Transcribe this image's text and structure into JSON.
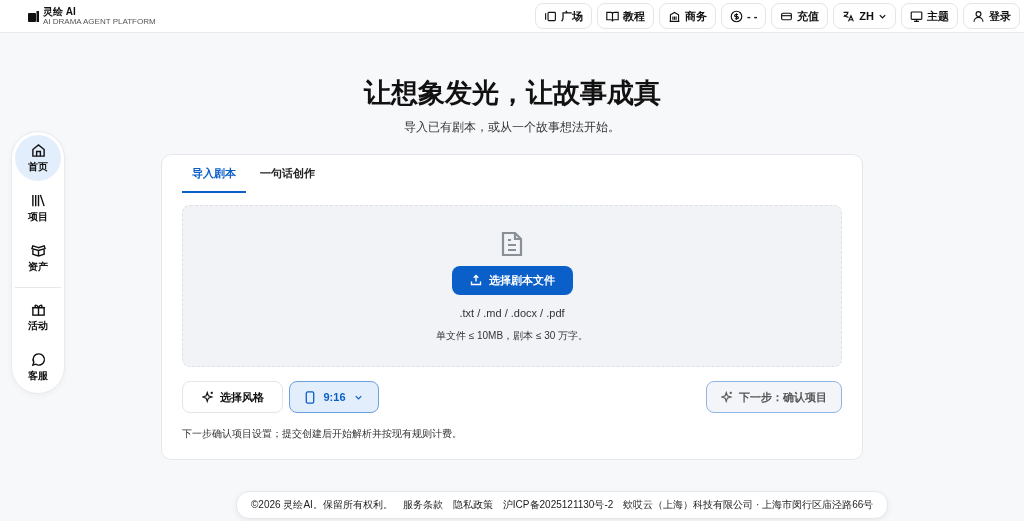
{
  "logo": {
    "name": "灵绘 AI",
    "tagline": "AI DRAMA AGENT PLATFORM"
  },
  "nav": [
    {
      "label": "广场"
    },
    {
      "label": "教程"
    },
    {
      "label": "商务"
    },
    {
      "label": "- -"
    },
    {
      "label": "充值"
    },
    {
      "label": "ZH",
      "dropdown": true
    },
    {
      "label": "主题"
    },
    {
      "label": "登录"
    }
  ],
  "sidebar": {
    "items": [
      {
        "label": "首页",
        "selected": true
      },
      {
        "label": "项目",
        "selected": false
      },
      {
        "label": "资产",
        "selected": false
      },
      {
        "label": "活动",
        "selected": false,
        "divider_before": true
      },
      {
        "label": "客服",
        "selected": false
      }
    ]
  },
  "hero": {
    "title": "让想象发光，让故事成真",
    "subtitle": "导入已有剧本，或从一个故事想法开始。"
  },
  "tabs": [
    {
      "label": "导入剧本",
      "selected": true
    },
    {
      "label": "一句话创作",
      "selected": false
    }
  ],
  "upload": {
    "button": "选择剧本文件",
    "formats": ".txt / .md / .docx / .pdf",
    "limits": "单文件 ≤ 10MB，剧本 ≤ 30 万字。"
  },
  "style_button": "选择风格",
  "ratio": {
    "label": "9:16"
  },
  "next_button": {
    "label": "下一步：确认项目",
    "disabled": true
  },
  "note": "下一步确认项目设置；提交创建后开始解析并按现有规则计费。",
  "footer": [
    "©2026 灵绘AI。保留所有权利。",
    "服务条款",
    "隐私政策",
    "沪ICP备2025121130号-2",
    "欸哎云（上海）科技有限公司 · 上海市闵行区庙泾路66号"
  ]
}
